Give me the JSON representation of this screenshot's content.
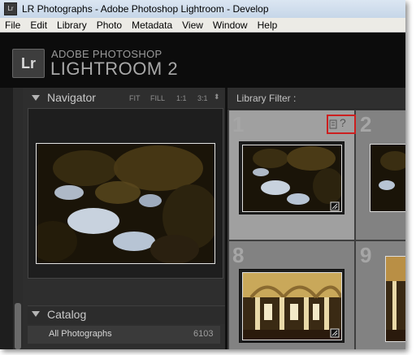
{
  "window": {
    "title": "LR Photographs - Adobe Photoshop Lightroom - Develop",
    "app_icon": "lightroom-app-icon"
  },
  "menu": [
    "File",
    "Edit",
    "Library",
    "Photo",
    "Metadata",
    "View",
    "Window",
    "Help"
  ],
  "identity_plate": {
    "badge": "Lr",
    "line1": "ADOBE PHOTOSHOP",
    "line2": "LIGHTROOM 2"
  },
  "navigator": {
    "title": "Navigator",
    "zoom_options": [
      "FIT",
      "FILL",
      "1:1",
      "3:1"
    ],
    "zoom_more_icon": "updown-arrow-icon"
  },
  "catalog": {
    "title": "Catalog",
    "rows": [
      {
        "label": "All Photographs",
        "count": "6103"
      }
    ]
  },
  "library_filter": {
    "label": "Library Filter :"
  },
  "grid": {
    "cells": [
      {
        "number": "1",
        "selected": true,
        "badges": "?"
      },
      {
        "number": "2",
        "selected": false
      },
      {
        "number": "8",
        "selected": false
      },
      {
        "number": "9",
        "selected": false
      }
    ]
  },
  "colors": {
    "accent_highlight": "#cc1f1f",
    "panel_bg": "#2e2e2e",
    "grid_bg": "#828282",
    "selected_cell": "#a0a0a0"
  }
}
